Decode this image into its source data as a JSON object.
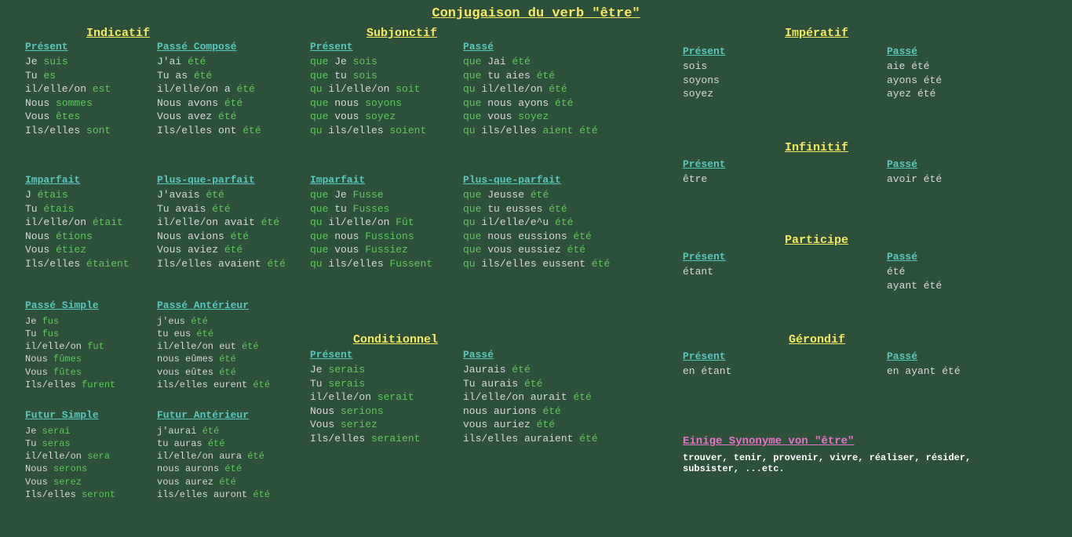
{
  "title": "Conjugaison du verb \"être\"",
  "moods": {
    "indicatif": "Indicatif",
    "subjonctif": "Subjonctif",
    "conditionnel": "Conditionnel",
    "imperatif": "Impératif",
    "infinitif": "Infinitif",
    "participe": "Participe",
    "gerondif": "Gérondif"
  },
  "ind_present": {
    "title": "Présent",
    "rows": [
      {
        "p": "Je",
        "c": "suis"
      },
      {
        "p": "Tu",
        "c": "es"
      },
      {
        "p": "il/elle/on",
        "c": "est"
      },
      {
        "p": "Nous",
        "c": "sommes"
      },
      {
        "p": "Vous",
        "c": "êtes"
      },
      {
        "p": "Ils/elles",
        "c": "sont"
      }
    ]
  },
  "ind_passe_compose": {
    "title": "Passé Composé",
    "rows": [
      {
        "p": "J'ai",
        "c": "été"
      },
      {
        "p": "Tu as",
        "c": "été"
      },
      {
        "p": "il/elle/on a",
        "c": "été"
      },
      {
        "p": "Nous avons",
        "c": "été"
      },
      {
        "p": "Vous avez",
        "c": "été"
      },
      {
        "p": "Ils/elles ont",
        "c": "été"
      }
    ]
  },
  "ind_imparfait": {
    "title": "Imparfait",
    "rows": [
      {
        "p": "J",
        "c": "étais"
      },
      {
        "p": "Tu",
        "c": "étais"
      },
      {
        "p": "il/elle/on",
        "c": "était"
      },
      {
        "p": "Nous",
        "c": "étions"
      },
      {
        "p": "Vous",
        "c": "étiez"
      },
      {
        "p": "Ils/elles",
        "c": "étaient"
      }
    ]
  },
  "ind_pqp": {
    "title": "Plus-que-parfait",
    "rows": [
      {
        "p": "J'avais",
        "c": "été"
      },
      {
        "p": "Tu avais",
        "c": "été"
      },
      {
        "p": "il/elle/on avait",
        "c": "été"
      },
      {
        "p": "Nous avions",
        "c": "été"
      },
      {
        "p": "Vous aviez",
        "c": "été"
      },
      {
        "p": "Ils/elles avaient",
        "c": "été"
      }
    ]
  },
  "ind_passe_simple": {
    "title": "Passé Simple",
    "rows": [
      {
        "p": "Je",
        "c": "fus"
      },
      {
        "p": "Tu",
        "c": "fus"
      },
      {
        "p": "il/elle/on",
        "c": "fut"
      },
      {
        "p": "Nous",
        "c": "fûmes"
      },
      {
        "p": "Vous",
        "c": "fûtes"
      },
      {
        "p": "Ils/elles",
        "c": "furent"
      }
    ]
  },
  "ind_passe_ant": {
    "title": "Passé Antérieur",
    "rows": [
      {
        "p": "j'eus",
        "c": "été"
      },
      {
        "p": "tu eus",
        "c": "été"
      },
      {
        "p": "il/elle/on eut",
        "c": "été"
      },
      {
        "p": "nous eûmes",
        "c": "été"
      },
      {
        "p": "vous eûtes",
        "c": "été"
      },
      {
        "p": "ils/elles eurent",
        "c": "été"
      }
    ]
  },
  "ind_futur_simple": {
    "title": "Futur Simple",
    "rows": [
      {
        "p": "Je",
        "c": "serai"
      },
      {
        "p": "Tu",
        "c": "seras"
      },
      {
        "p": "il/elle/on",
        "c": "sera"
      },
      {
        "p": "Nous",
        "c": "serons"
      },
      {
        "p": "Vous",
        "c": "serez"
      },
      {
        "p": "Ils/elles",
        "c": "seront"
      }
    ]
  },
  "ind_futur_ant": {
    "title": "Futur Antérieur",
    "rows": [
      {
        "p": "j'aurai",
        "c": "été"
      },
      {
        "p": "tu auras",
        "c": "été"
      },
      {
        "p": "il/elle/on aura",
        "c": "été"
      },
      {
        "p": "nous aurons",
        "c": "été"
      },
      {
        "p": "vous aurez",
        "c": "été"
      },
      {
        "p": "ils/elles auront",
        "c": "été"
      }
    ]
  },
  "sub_present": {
    "title": "Présent",
    "rows": [
      {
        "q": "que",
        "p": "Je",
        "c": "sois"
      },
      {
        "q": "que",
        "p": "tu",
        "c": "sois"
      },
      {
        "q": "qu",
        "p": "il/elle/on",
        "c": "soit"
      },
      {
        "q": "que",
        "p": "nous",
        "c": "soyons"
      },
      {
        "q": "que",
        "p": "vous",
        "c": "soyez"
      },
      {
        "q": "qu",
        "p": "ils/elles",
        "c": "soient"
      }
    ]
  },
  "sub_passe": {
    "title": "Passé",
    "rows": [
      {
        "q": "que",
        "p": "Jai",
        "c": "été"
      },
      {
        "q": "que",
        "p": "tu aies",
        "c": "été"
      },
      {
        "q": "qu",
        "p": "il/elle/on",
        "c": "été"
      },
      {
        "q": "que",
        "p": "nous ayons",
        "c": "été"
      },
      {
        "q": "que",
        "p": "vous",
        "c": "soyez"
      },
      {
        "q": "qu",
        "p": "ils/elles",
        "c": "aient été"
      }
    ]
  },
  "sub_imparfait": {
    "title": "Imparfait",
    "rows": [
      {
        "q": "que",
        "p": "Je",
        "c": "Fusse"
      },
      {
        "q": "que",
        "p": "tu",
        "c": "Fusses"
      },
      {
        "q": "qu",
        "p": "il/elle/on",
        "c": "Fût"
      },
      {
        "q": "que",
        "p": "nous",
        "c": "Fussions"
      },
      {
        "q": "que",
        "p": "vous",
        "c": "Fussiez"
      },
      {
        "q": "qu",
        "p": "ils/elles",
        "c": "Fussent"
      }
    ]
  },
  "sub_pqp": {
    "title": "Plus-que-parfait",
    "rows": [
      {
        "q": "que",
        "p": "Jeusse",
        "c": "été"
      },
      {
        "q": "que",
        "p": "tu eusses",
        "c": "été"
      },
      {
        "q": "qu",
        "p": "il/elle/e^u",
        "c": "été"
      },
      {
        "q": "que",
        "p": "nous eussions",
        "c": "été"
      },
      {
        "q": "que",
        "p": "vous eussiez",
        "c": "été"
      },
      {
        "q": "qu",
        "p": "ils/elles eussent",
        "c": "été"
      }
    ]
  },
  "cond_present": {
    "title": "Présent",
    "rows": [
      {
        "p": "Je",
        "c": "serais"
      },
      {
        "p": "Tu",
        "c": "serais"
      },
      {
        "p": "il/elle/on",
        "c": "serait"
      },
      {
        "p": "Nous",
        "c": "serions"
      },
      {
        "p": "Vous",
        "c": "seriez"
      },
      {
        "p": "Ils/elles",
        "c": "seraient"
      }
    ]
  },
  "cond_passe": {
    "title": "Passé",
    "rows": [
      {
        "p": "Jaurais",
        "c": "été"
      },
      {
        "p": "Tu aurais",
        "c": "été"
      },
      {
        "p": "il/elle/on aurait",
        "c": "été"
      },
      {
        "p": "nous aurions",
        "c": "été"
      },
      {
        "p": "vous auriez",
        "c": "été"
      },
      {
        "p": "ils/elles auraient",
        "c": "été"
      }
    ]
  },
  "imp_present": {
    "title": "Présent",
    "lines": [
      "sois",
      "soyons",
      "soyez"
    ]
  },
  "imp_passe": {
    "title": "Passé",
    "lines": [
      "aie été",
      "ayons été",
      "ayez été"
    ]
  },
  "inf_present": {
    "title": "Présent",
    "lines": [
      "être"
    ]
  },
  "inf_passe": {
    "title": "Passé",
    "lines": [
      "avoir été"
    ]
  },
  "part_present": {
    "title": "Présent",
    "lines": [
      "étant"
    ]
  },
  "part_passe": {
    "title": "Passé",
    "lines": [
      "été",
      "ayant été"
    ]
  },
  "ger_present": {
    "title": "Présent",
    "lines": [
      "en étant"
    ]
  },
  "ger_passe": {
    "title": "Passé",
    "lines": [
      "en ayant été"
    ]
  },
  "syn": {
    "title": "Einige Synonyme von \"être\"",
    "body": "trouver, tenir, provenir, vivre, réaliser, résider, subsister, ...etc."
  }
}
